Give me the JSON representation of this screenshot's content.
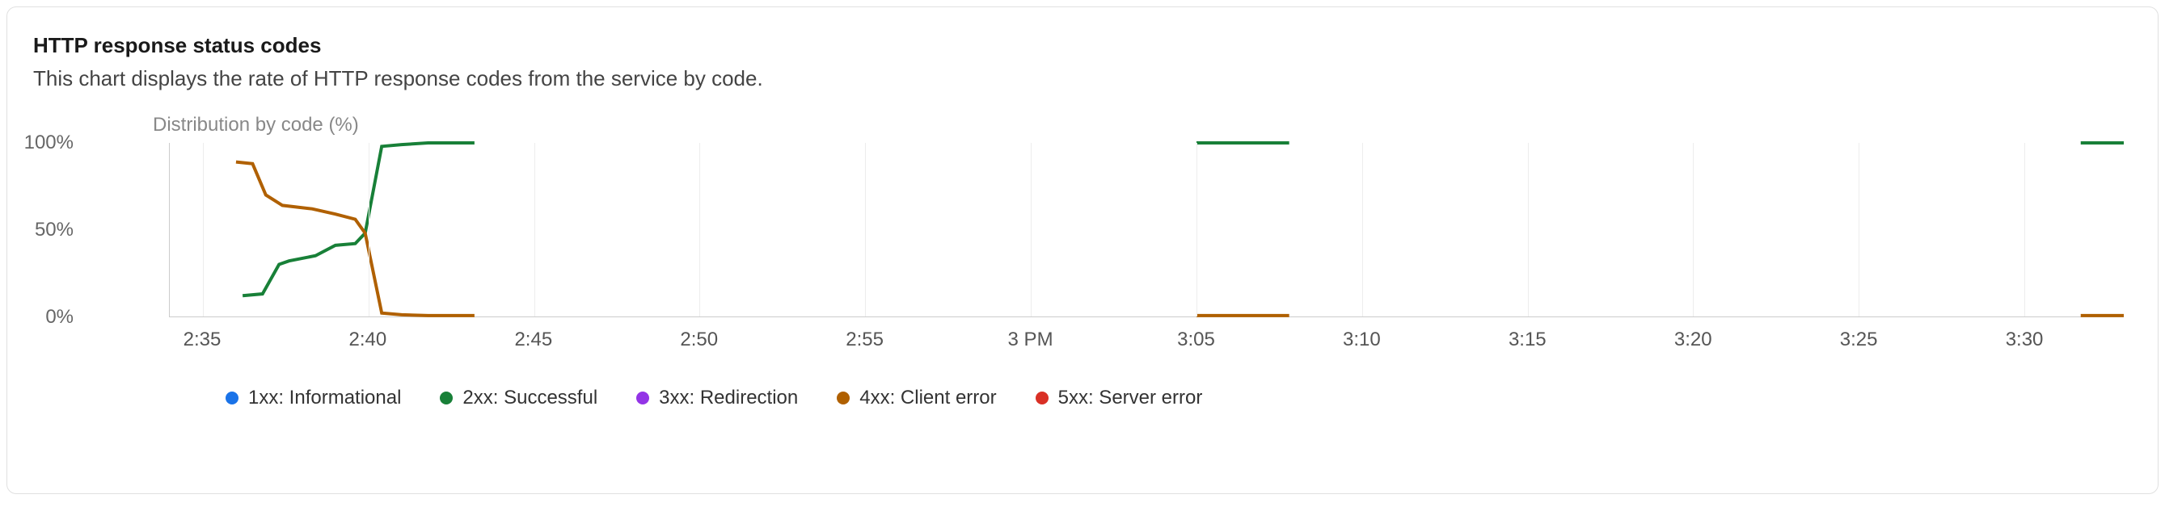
{
  "panel": {
    "title": "HTTP response status codes",
    "subtitle": "This chart displays the rate of HTTP response codes from the service by code."
  },
  "chart_label": "Distribution by code (%)",
  "y_ticks": [
    {
      "label": "100%",
      "v": 100
    },
    {
      "label": "50%",
      "v": 50
    },
    {
      "label": "0%",
      "v": 0
    }
  ],
  "x_ticks": [
    {
      "label": "2:35",
      "t": 155
    },
    {
      "label": "2:40",
      "t": 160
    },
    {
      "label": "2:45",
      "t": 165
    },
    {
      "label": "2:50",
      "t": 170
    },
    {
      "label": "2:55",
      "t": 175
    },
    {
      "label": "3 PM",
      "t": 180
    },
    {
      "label": "3:05",
      "t": 185
    },
    {
      "label": "3:10",
      "t": 190
    },
    {
      "label": "3:15",
      "t": 195
    },
    {
      "label": "3:20",
      "t": 200
    },
    {
      "label": "3:25",
      "t": 205
    },
    {
      "label": "3:30",
      "t": 210
    }
  ],
  "legend": [
    {
      "name": "1xx: Informational",
      "color": "#1a73e8"
    },
    {
      "name": "2xx: Successful",
      "color": "#188038"
    },
    {
      "name": "3xx: Redirection",
      "color": "#9334e6"
    },
    {
      "name": "4xx: Client error",
      "color": "#b06000"
    },
    {
      "name": "5xx: Server error",
      "color": "#d93025"
    }
  ],
  "chart_data": {
    "type": "line",
    "title": "Distribution by code (%)",
    "xlabel": "",
    "ylabel": "Distribution by code (%)",
    "ylim": [
      0,
      100
    ],
    "xrange_minutes": [
      154,
      213
    ],
    "x_tick_labels": [
      "2:35",
      "2:40",
      "2:45",
      "2:50",
      "2:55",
      "3 PM",
      "3:05",
      "3:10",
      "3:15",
      "3:20",
      "3:25",
      "3:30"
    ],
    "series": [
      {
        "name": "2xx: Successful",
        "color": "#188038",
        "segments": [
          [
            {
              "t": 156.2,
              "v": 12
            },
            {
              "t": 156.8,
              "v": 13
            },
            {
              "t": 157.3,
              "v": 30
            },
            {
              "t": 157.6,
              "v": 32
            },
            {
              "t": 158.4,
              "v": 35
            },
            {
              "t": 159.0,
              "v": 41
            },
            {
              "t": 159.6,
              "v": 42
            },
            {
              "t": 159.9,
              "v": 48
            },
            {
              "t": 160.4,
              "v": 98
            },
            {
              "t": 161.0,
              "v": 99
            },
            {
              "t": 161.8,
              "v": 100
            },
            {
              "t": 163.2,
              "v": 100
            }
          ],
          [
            {
              "t": 185.0,
              "v": 100
            },
            {
              "t": 187.8,
              "v": 100
            }
          ],
          [
            {
              "t": 211.7,
              "v": 100
            },
            {
              "t": 213.0,
              "v": 100
            }
          ]
        ]
      },
      {
        "name": "4xx: Client error",
        "color": "#b06000",
        "segments": [
          [
            {
              "t": 156.0,
              "v": 89
            },
            {
              "t": 156.5,
              "v": 88
            },
            {
              "t": 156.9,
              "v": 70
            },
            {
              "t": 157.4,
              "v": 64
            },
            {
              "t": 158.3,
              "v": 62
            },
            {
              "t": 159.0,
              "v": 59
            },
            {
              "t": 159.6,
              "v": 56
            },
            {
              "t": 159.9,
              "v": 48
            },
            {
              "t": 160.4,
              "v": 2
            },
            {
              "t": 161.0,
              "v": 1
            },
            {
              "t": 161.8,
              "v": 0.5
            },
            {
              "t": 163.2,
              "v": 0.5
            }
          ],
          [
            {
              "t": 185.0,
              "v": 0.5
            },
            {
              "t": 187.8,
              "v": 0.5
            }
          ],
          [
            {
              "t": 211.7,
              "v": 0.5
            },
            {
              "t": 213.0,
              "v": 0.5
            }
          ]
        ]
      }
    ]
  }
}
